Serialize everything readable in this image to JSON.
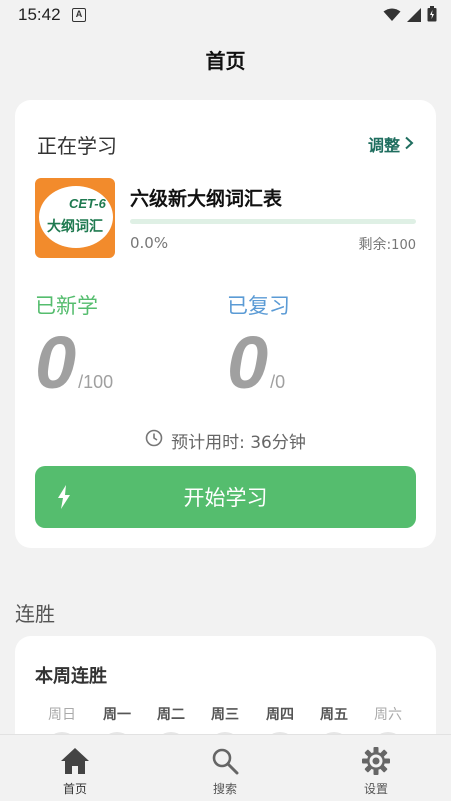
{
  "status": {
    "time": "15:42",
    "a_glyph": "A"
  },
  "header": {
    "title": "首页"
  },
  "learning": {
    "title": "正在学习",
    "adjust_label": "调整",
    "book": {
      "cover_top": "CET-6",
      "cover_bottom": "大纲词汇",
      "name": "六级新大纲词汇表",
      "progress_fraction": 0.0,
      "progress_label": "0.0%",
      "remaining_label": "剩余:",
      "remaining_value": "100"
    },
    "new_stat": {
      "label": "已新学",
      "value": "0",
      "total": "/100"
    },
    "review_stat": {
      "label": "已复习",
      "value": "0",
      "total": "/0"
    },
    "estimate": "预计用时: 36分钟",
    "start_button": "开始学习"
  },
  "streak": {
    "section_title": "连胜",
    "card_title": "本周连胜",
    "days": [
      "周日",
      "周一",
      "周二",
      "周三",
      "周四",
      "周五",
      "周六"
    ]
  },
  "nav": {
    "items": [
      {
        "label": "首页",
        "icon": "home-icon"
      },
      {
        "label": "搜索",
        "icon": "search-icon"
      },
      {
        "label": "设置",
        "icon": "gear-icon"
      }
    ]
  },
  "colors": {
    "accent": "#55bd6e",
    "review": "#5b9bd5",
    "link": "#1f6e5f",
    "cover": "#f28b2c"
  }
}
